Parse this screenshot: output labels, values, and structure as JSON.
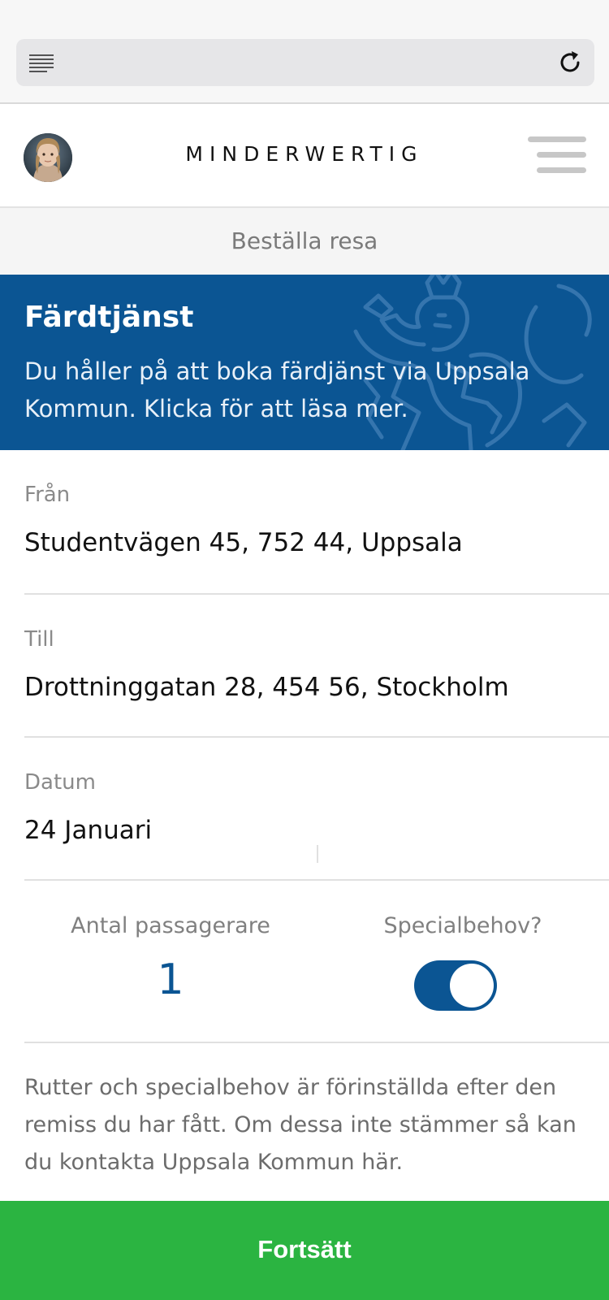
{
  "browser": {
    "menu_icon": "reader-menu-icon",
    "reload_icon": "reload-icon"
  },
  "header": {
    "brand": "MINDERWERTIG",
    "avatar_icon": "user-avatar",
    "menu_icon": "hamburger-menu-icon"
  },
  "page": {
    "subtitle": "Beställa resa"
  },
  "banner": {
    "title": "Färdtjänst",
    "text": "Du håller på att boka färdjänst via Uppsala Kommun. Klicka för att läsa mer.",
    "emblem_icon": "heraldic-lion-emblem",
    "color": "#0b5593"
  },
  "form": {
    "from": {
      "label": "Från",
      "value": "Studentvägen 45, 752 44, Uppsala"
    },
    "to": {
      "label": "Till",
      "value": "Drottninggatan 28, 454 56, Stockholm"
    },
    "date": {
      "label": "Datum",
      "value": "24 Januari"
    },
    "passengers": {
      "label": "Antal passagerare",
      "value": "1"
    },
    "special_needs": {
      "label": "Specialbehov?",
      "enabled": true
    }
  },
  "note": "Rutter och specialbehov är förinställda efter den remiss du har fått. Om dessa inte stämmer så kan du kontakta Uppsala Kommun här.",
  "continue_button": {
    "label": "Fortsätt",
    "color": "#2bb441"
  }
}
